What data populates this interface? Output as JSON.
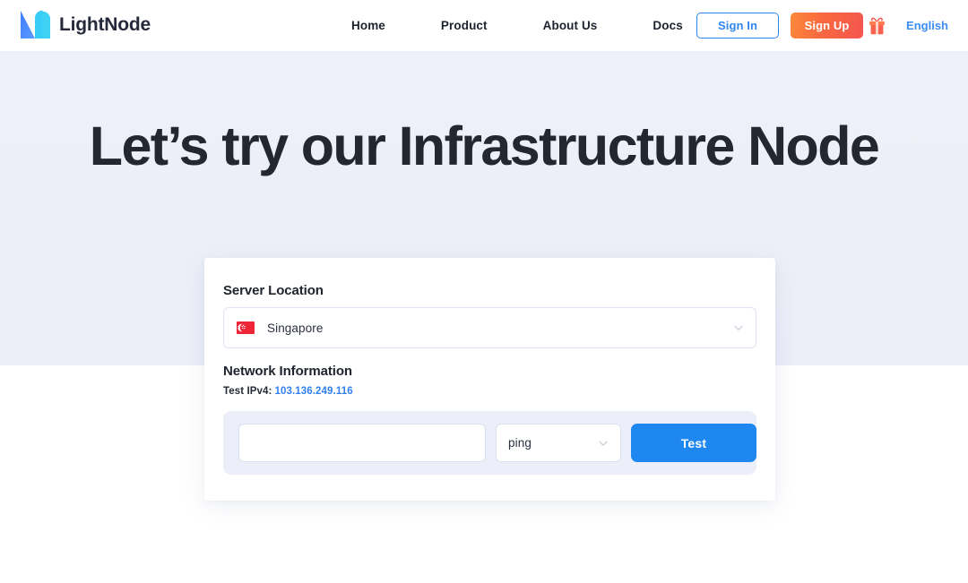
{
  "header": {
    "brand": {
      "name": "LightNode",
      "logo_icon": "lightnode-logo-icon"
    },
    "nav": [
      {
        "label": "Home"
      },
      {
        "label": "Product"
      },
      {
        "label": "About Us"
      },
      {
        "label": "Docs"
      }
    ],
    "sign_in_label": "Sign In",
    "sign_up_label": "Sign Up",
    "gift_icon": "gift-icon",
    "language_label": "English",
    "colors": {
      "accent_blue": "#2f86f0",
      "signup_gradient_start": "#fb8a3c",
      "signup_gradient_end": "#f4564f"
    }
  },
  "hero": {
    "title": "Let’s try our Infrastructure Node",
    "background": "#edeff8"
  },
  "card": {
    "server_location": {
      "label": "Server Location",
      "selected": "Singapore",
      "flag_icon": "singapore-flag-icon",
      "chevron_icon": "chevron-down-icon"
    },
    "network_information": {
      "label": "Network Information",
      "ipv4_label": "Test IPv4:",
      "ipv4_value": "103.136.249.116",
      "ipv4_color": "#2f7fef"
    },
    "test_panel": {
      "host_value": "",
      "host_placeholder": "",
      "method_selected": "ping",
      "method_chevron_icon": "chevron-down-icon",
      "test_button_label": "Test",
      "test_button_color": "#1e87f0",
      "panel_background": "#eceffa"
    }
  }
}
